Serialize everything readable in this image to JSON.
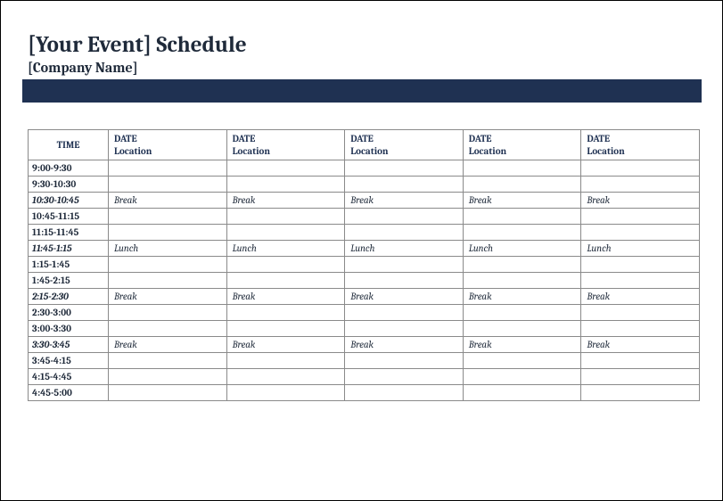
{
  "header": {
    "title": "[Your Event] Schedule",
    "subtitle": "[Company Name]"
  },
  "table": {
    "time_header": "TIME",
    "columns": [
      {
        "date": "DATE",
        "location": "Location"
      },
      {
        "date": "DATE",
        "location": "Location"
      },
      {
        "date": "DATE",
        "location": "Location"
      },
      {
        "date": "DATE",
        "location": "Location"
      },
      {
        "date": "DATE",
        "location": "Location"
      }
    ],
    "rows": [
      {
        "time": "9:00-9:30",
        "type": "normal",
        "cells": [
          "",
          "",
          "",
          "",
          ""
        ]
      },
      {
        "time": "9:30-10:30",
        "type": "normal",
        "cells": [
          "",
          "",
          "",
          "",
          ""
        ]
      },
      {
        "time": "10:30-10:45",
        "type": "break",
        "cells": [
          "Break",
          "Break",
          "Break",
          "Break",
          "Break"
        ]
      },
      {
        "time": "10:45-11:15",
        "type": "normal",
        "cells": [
          "",
          "",
          "",
          "",
          ""
        ]
      },
      {
        "time": "11:15-11:45",
        "type": "normal",
        "cells": [
          "",
          "",
          "",
          "",
          ""
        ]
      },
      {
        "time": "11:45-1:15",
        "type": "break",
        "cells": [
          "Lunch",
          "Lunch",
          "Lunch",
          "Lunch",
          "Lunch"
        ]
      },
      {
        "time": "1:15-1:45",
        "type": "normal",
        "cells": [
          "",
          "",
          "",
          "",
          ""
        ]
      },
      {
        "time": "1:45-2:15",
        "type": "normal",
        "cells": [
          "",
          "",
          "",
          "",
          ""
        ]
      },
      {
        "time": "2:15-2:30",
        "type": "break",
        "cells": [
          "Break",
          "Break",
          "Break",
          "Break",
          "Break"
        ]
      },
      {
        "time": "2:30-3:00",
        "type": "normal",
        "cells": [
          "",
          "",
          "",
          "",
          ""
        ]
      },
      {
        "time": "3:00-3:30",
        "type": "normal",
        "cells": [
          "",
          "",
          "",
          "",
          ""
        ]
      },
      {
        "time": "3:30-3:45",
        "type": "break",
        "cells": [
          "Break",
          "Break",
          "Break",
          "Break",
          "Break"
        ]
      },
      {
        "time": "3:45-4:15",
        "type": "normal",
        "cells": [
          "",
          "",
          "",
          "",
          ""
        ]
      },
      {
        "time": "4:15-4:45",
        "type": "normal",
        "cells": [
          "",
          "",
          "",
          "",
          ""
        ]
      },
      {
        "time": "4:45-5:00",
        "type": "normal",
        "cells": [
          "",
          "",
          "",
          "",
          ""
        ]
      }
    ]
  }
}
